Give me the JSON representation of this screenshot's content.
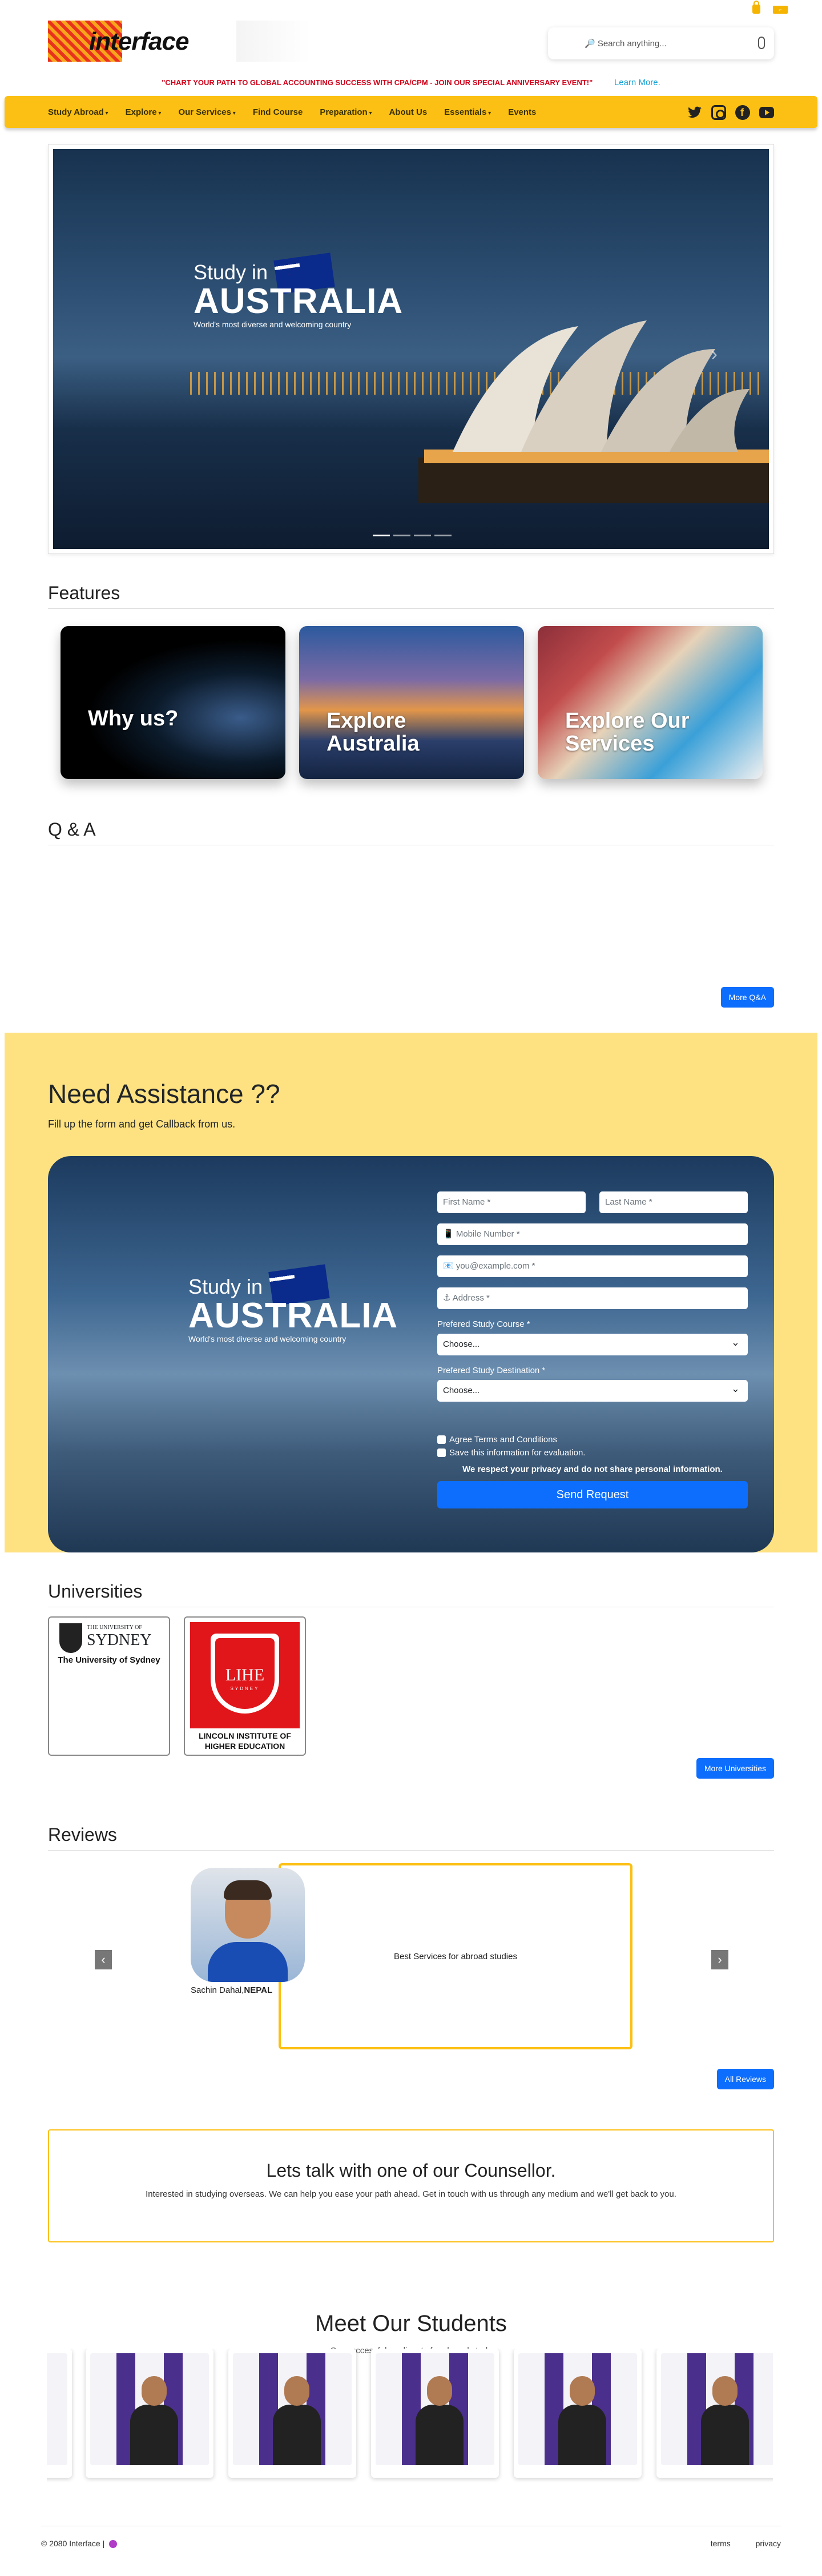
{
  "top_icons": [
    "lock-icon",
    "key-icon"
  ],
  "brand": {
    "name": "interface"
  },
  "search": {
    "placeholder": "🔎 Search anything..."
  },
  "announcement": {
    "text": "\"CHART YOUR PATH TO GLOBAL ACCOUNTING SUCCESS WITH CPA/CPM - JOIN OUR SPECIAL ANNIVERSARY EVENT!\"",
    "link": "Learn More."
  },
  "nav": {
    "items": [
      {
        "label": "Study Abroad",
        "dropdown": true
      },
      {
        "label": "Explore",
        "dropdown": true
      },
      {
        "label": "Our Services",
        "dropdown": true
      },
      {
        "label": "Find Course",
        "dropdown": false
      },
      {
        "label": "Preparation",
        "dropdown": true
      },
      {
        "label": "About Us",
        "dropdown": false
      },
      {
        "label": "Essentials",
        "dropdown": true
      },
      {
        "label": "Events",
        "dropdown": false
      }
    ],
    "social": [
      "twitter-icon",
      "instagram-icon",
      "facebook-icon",
      "youtube-icon"
    ]
  },
  "hero": {
    "line1": "Study in",
    "line2": "AUSTRALIA",
    "line3": "World's most diverse and welcoming country"
  },
  "features": {
    "heading": "Features",
    "cards": [
      "Why us?",
      "Explore Australia",
      "Explore Our Services"
    ]
  },
  "qa": {
    "heading": "Q & A",
    "more": "More Q&A"
  },
  "assistance": {
    "heading": "Need Assistance ??",
    "subheading": "Fill up the form and get Callback from us.",
    "first_name": "First Name *",
    "last_name": "Last Name *",
    "mobile": "📱 Mobile Number *",
    "email": "📧 you@example.com *",
    "address": "⚓ Address *",
    "course_label": "Prefered Study Course *",
    "course_value": "Choose...",
    "destination_label": "Prefered Study Destination *",
    "destination_value": "Choose...",
    "agree": "Agree Terms and Conditions",
    "save": "Save this information for evaluation.",
    "privacy": "We respect your privacy and do not share personal information.",
    "submit": "Send Request"
  },
  "universities": {
    "heading": "Universities",
    "items": [
      {
        "name": "The University of Sydney",
        "logo_top": "THE UNIVERSITY OF",
        "logo_main": "SYDNEY"
      },
      {
        "name": "LINCOLN INSTITUTE OF HIGHER EDUCATION",
        "logo_main": "LIHE",
        "logo_sub": "SYDNEY"
      }
    ],
    "more": "More Universities"
  },
  "reviews": {
    "heading": "Reviews",
    "reviewer": "Sachin Dahal,",
    "country": "NEPAL",
    "text": "Best Services for abroad studies",
    "prev": "‹",
    "next": "›",
    "all": "All Reviews"
  },
  "counsellor": {
    "heading": "Lets talk with one of our Counsellor.",
    "text": "Interested in studying overseas. We can help you ease your path ahead. Get in touch with us through any medium and we'll get back to you."
  },
  "students": {
    "heading": "Meet Our Students",
    "subheading": "Our successful applicants for abroad study",
    "count": 6
  },
  "footer": {
    "copyright": "© 2080 Interface |",
    "links": [
      "terms",
      "privacy"
    ]
  }
}
